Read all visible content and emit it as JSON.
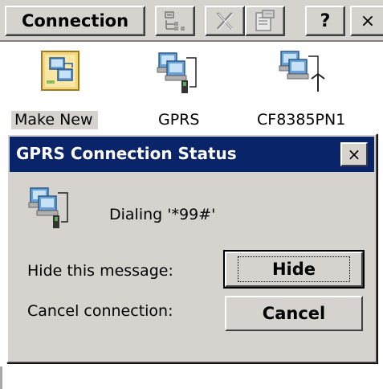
{
  "toolbar": {
    "menu_label": "Connection",
    "buttons": [
      {
        "icon": "view-details-icon"
      },
      {
        "icon": "delete-icon"
      },
      {
        "icon": "properties-icon"
      },
      {
        "label": "?"
      },
      {
        "label": "×"
      }
    ]
  },
  "connections": [
    {
      "label": "Make New",
      "icon": "make-new-connection-icon"
    },
    {
      "label": "GPRS",
      "icon": "network-connection-icon"
    },
    {
      "label": "CF8385PN1",
      "icon": "wireless-connection-icon"
    }
  ],
  "dialog": {
    "title": "GPRS Connection Status",
    "close_label": "×",
    "status": "Dialing '*99#'",
    "hide_label": "Hide this message:",
    "hide_button": "Hide",
    "cancel_label": "Cancel connection:",
    "cancel_button": "Cancel"
  },
  "colors": {
    "titlebar": "#0a246a",
    "face": "#d6d3ce"
  }
}
